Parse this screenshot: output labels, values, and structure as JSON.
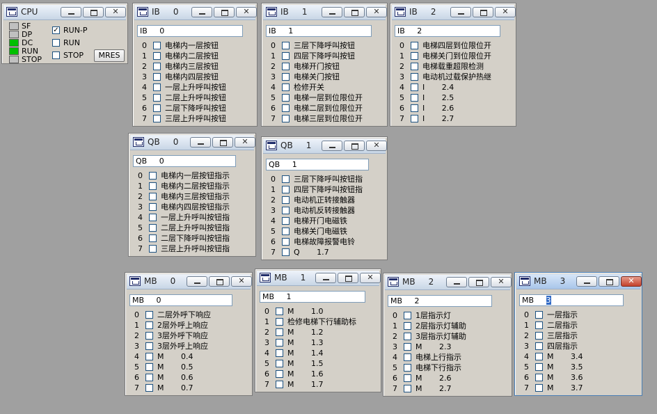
{
  "cpu": {
    "title": "CPU",
    "leds": [
      {
        "label": "SF",
        "on": false
      },
      {
        "label": "DP",
        "on": false
      },
      {
        "label": "DC",
        "on": true
      },
      {
        "label": "RUN",
        "on": true
      },
      {
        "label": "STOP",
        "on": false
      }
    ],
    "modes": [
      {
        "label": "RUN-P",
        "checked": true
      },
      {
        "label": "RUN",
        "checked": false
      },
      {
        "label": "STOP",
        "checked": false
      }
    ],
    "mres_label": "MRES",
    "check_mark": "✓"
  },
  "close_glyph": "✕",
  "windows": [
    {
      "title": "IB     0",
      "field": "IB     0",
      "rows": [
        {
          "idx": "0",
          "label": "电梯内一层按钮"
        },
        {
          "idx": "1",
          "label": "电梯内二层按钮"
        },
        {
          "idx": "2",
          "label": "电梯内三层按钮"
        },
        {
          "idx": "3",
          "label": "电梯内四层按钮"
        },
        {
          "idx": "4",
          "label": "一层上升呼叫按钮"
        },
        {
          "idx": "5",
          "label": "二层上升呼叫按钮"
        },
        {
          "idx": "6",
          "label": "二层下降呼叫按钮"
        },
        {
          "idx": "7",
          "label": "三层上升呼叫按钮"
        }
      ]
    },
    {
      "title": "IB     1",
      "field": "IB     1",
      "rows": [
        {
          "idx": "0",
          "label": "三层下降呼叫按钮"
        },
        {
          "idx": "1",
          "label": "四层下降呼叫按钮"
        },
        {
          "idx": "2",
          "label": "电梯开门按钮"
        },
        {
          "idx": "3",
          "label": "电梯关门按钮"
        },
        {
          "idx": "4",
          "label": "检修开关"
        },
        {
          "idx": "5",
          "label": "电梯一层到位限位开"
        },
        {
          "idx": "6",
          "label": "电梯二层到位限位开"
        },
        {
          "idx": "7",
          "label": "电梯三层到位限位开"
        }
      ]
    },
    {
      "title": "IB     2",
      "field": "IB     2",
      "rows": [
        {
          "idx": "0",
          "label": "电梯四层到位限位开"
        },
        {
          "idx": "1",
          "label": "电梯关门到位限位开"
        },
        {
          "idx": "2",
          "label": "电梯载重超限检测"
        },
        {
          "idx": "3",
          "label": "电动机过载保护热继"
        },
        {
          "idx": "4",
          "label": "I       2.4"
        },
        {
          "idx": "5",
          "label": "I       2.5"
        },
        {
          "idx": "6",
          "label": "I       2.6"
        },
        {
          "idx": "7",
          "label": "I       2.7"
        }
      ]
    },
    {
      "title": "QB     0",
      "field": "QB     0",
      "rows": [
        {
          "idx": "0",
          "label": "电梯内一层按钮指示"
        },
        {
          "idx": "1",
          "label": "电梯内二层按钮指示"
        },
        {
          "idx": "2",
          "label": "电梯内三层按钮指示"
        },
        {
          "idx": "3",
          "label": "电梯内四层按钮指示"
        },
        {
          "idx": "4",
          "label": "一层上升呼叫按钮指"
        },
        {
          "idx": "5",
          "label": "二层上升呼叫按钮指"
        },
        {
          "idx": "6",
          "label": "二层下降呼叫按钮指"
        },
        {
          "idx": "7",
          "label": "三层上升呼叫按钮指"
        }
      ]
    },
    {
      "title": "QB     1",
      "field": "QB     1",
      "rows": [
        {
          "idx": "0",
          "label": "三层下降呼叫按钮指"
        },
        {
          "idx": "1",
          "label": "四层下降呼叫按钮指"
        },
        {
          "idx": "2",
          "label": "电动机正转接触器"
        },
        {
          "idx": "3",
          "label": "电动机反转接触器"
        },
        {
          "idx": "4",
          "label": "电梯开门电磁铁"
        },
        {
          "idx": "5",
          "label": "电梯关门电磁铁"
        },
        {
          "idx": "6",
          "label": "电梯故障报警电铃"
        },
        {
          "idx": "7",
          "label": "Q       1.7"
        }
      ]
    },
    {
      "title": "MB     0",
      "field": "MB     0",
      "rows": [
        {
          "idx": "0",
          "label": "二层外呼下响应"
        },
        {
          "idx": "1",
          "label": "2层外呼上响应"
        },
        {
          "idx": "2",
          "label": "3层外呼下响应"
        },
        {
          "idx": "3",
          "label": "3层外呼上响应"
        },
        {
          "idx": "4",
          "label": "M       0.4"
        },
        {
          "idx": "5",
          "label": "M       0.5"
        },
        {
          "idx": "6",
          "label": "M       0.6"
        },
        {
          "idx": "7",
          "label": "M       0.7"
        }
      ]
    },
    {
      "title": "MB     1",
      "field": "MB     1",
      "rows": [
        {
          "idx": "0",
          "label": "M       1.0"
        },
        {
          "idx": "1",
          "label": "检修电梯下行辅助标"
        },
        {
          "idx": "2",
          "label": "M       1.2"
        },
        {
          "idx": "3",
          "label": "M       1.3"
        },
        {
          "idx": "4",
          "label": "M       1.4"
        },
        {
          "idx": "5",
          "label": "M       1.5"
        },
        {
          "idx": "6",
          "label": "M       1.6"
        },
        {
          "idx": "7",
          "label": "M       1.7"
        }
      ]
    },
    {
      "title": "MB     2",
      "field": "MB     2",
      "rows": [
        {
          "idx": "0",
          "label": "1层指示灯"
        },
        {
          "idx": "1",
          "label": "2层指示灯辅助"
        },
        {
          "idx": "2",
          "label": "3层指示灯辅助"
        },
        {
          "idx": "3",
          "label": "M       2.3"
        },
        {
          "idx": "4",
          "label": "电梯上行指示"
        },
        {
          "idx": "5",
          "label": "电梯下行指示"
        },
        {
          "idx": "6",
          "label": "M       2.6"
        },
        {
          "idx": "7",
          "label": "M       2.7"
        }
      ]
    },
    {
      "title": "MB     3",
      "field_prefix": "MB     ",
      "field_selected": "3",
      "rows": [
        {
          "idx": "0",
          "label": "一层指示"
        },
        {
          "idx": "1",
          "label": "二层指示"
        },
        {
          "idx": "2",
          "label": "三层指示"
        },
        {
          "idx": "3",
          "label": "四层指示"
        },
        {
          "idx": "4",
          "label": "M       3.4"
        },
        {
          "idx": "5",
          "label": "M       3.5"
        },
        {
          "idx": "6",
          "label": "M       3.6"
        },
        {
          "idx": "7",
          "label": "M       3.7"
        }
      ]
    }
  ]
}
